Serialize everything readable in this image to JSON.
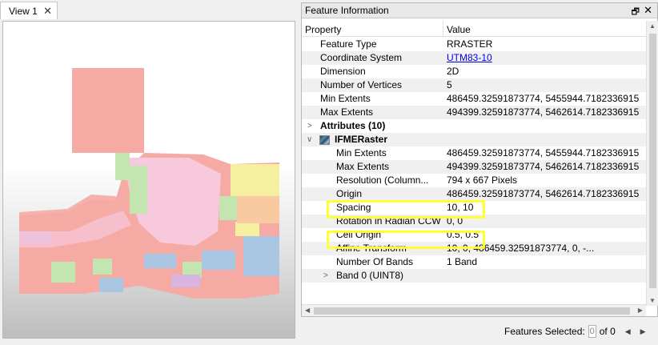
{
  "view": {
    "tab_label": "View 1",
    "close_glyph": "✕"
  },
  "info": {
    "title": "Feature Information",
    "restore_glyph": "🗗",
    "close_glyph": "✕",
    "columns": {
      "property": "Property",
      "value": "Value"
    },
    "rows": [
      {
        "property": "Feature Type",
        "value": "RRASTER"
      },
      {
        "property": "Coordinate System",
        "value": "UTM83-10"
      },
      {
        "property": "Dimension",
        "value": "2D"
      },
      {
        "property": "Number of Vertices",
        "value": "5"
      },
      {
        "property": "Min Extents",
        "value": "486459.32591873774, 5455944.7182336915"
      },
      {
        "property": "Max Extents",
        "value": "494399.32591873774, 5462614.7182336915"
      },
      {
        "property": "Attributes (10)",
        "value": ""
      },
      {
        "property": "IFMERaster",
        "value": ""
      },
      {
        "property": "Min Extents",
        "value": "486459.32591873774, 5455944.7182336915"
      },
      {
        "property": "Max Extents",
        "value": "494399.32591873774, 5462614.7182336915"
      },
      {
        "property": "Resolution (Column...",
        "value": "794 x 667 Pixels"
      },
      {
        "property": "Origin",
        "value": "486459.32591873774, 5462614.7182336915"
      },
      {
        "property": "Spacing",
        "value": "10, 10"
      },
      {
        "property": "Rotation in Radian CCW",
        "value": "0, 0"
      },
      {
        "property": "Cell Origin",
        "value": "0.5, 0.5"
      },
      {
        "property": "Affine Transform",
        "value": "10, 0, 486459.32591873774, 0, -..."
      },
      {
        "property": "Number Of Bands",
        "value": "1 Band"
      },
      {
        "property": "Band 0 (UINT8)",
        "value": ""
      }
    ]
  },
  "status": {
    "label": "Features Selected:",
    "selected": "0",
    "of_label": "of 0",
    "prev_glyph": "◀",
    "next_glyph": "▶"
  },
  "colors": {
    "highlight": "#ffff33",
    "link": "#0000ee",
    "map_salmon": "#f5aaa3",
    "map_pink": "#f8c8dc",
    "map_green": "#c3e6b0",
    "map_blue": "#a9c6e3",
    "map_yellow": "#f7efa0",
    "map_orange": "#f9c9a0",
    "map_purple": "#d9b6e0"
  }
}
